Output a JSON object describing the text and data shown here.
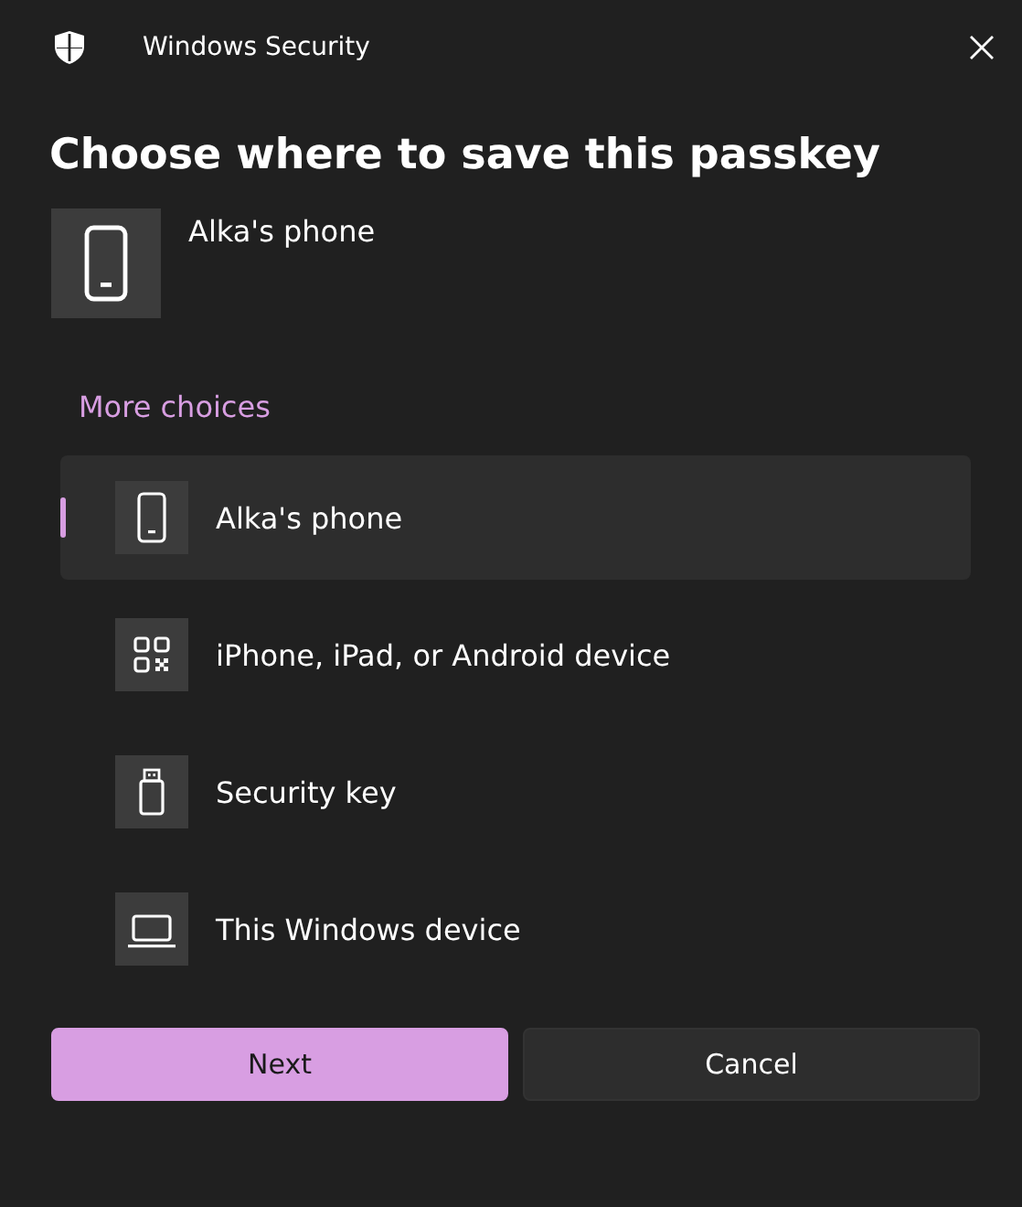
{
  "window": {
    "title": "Windows Security"
  },
  "heading": "Choose where to save this passkey",
  "current_device": {
    "kind": "phone",
    "label": "Alka's phone"
  },
  "more_choices": "More choices",
  "choices": [
    {
      "kind": "phone",
      "label": "Alka's phone",
      "selected": true
    },
    {
      "kind": "qr",
      "label": "iPhone, iPad, or Android device",
      "selected": false
    },
    {
      "kind": "usb",
      "label": "Security key",
      "selected": false
    },
    {
      "kind": "laptop",
      "label": "This Windows device",
      "selected": false
    }
  ],
  "buttons": [
    {
      "kind": "primary",
      "label": "Next"
    },
    {
      "kind": "secondary",
      "label": "Cancel"
    }
  ]
}
